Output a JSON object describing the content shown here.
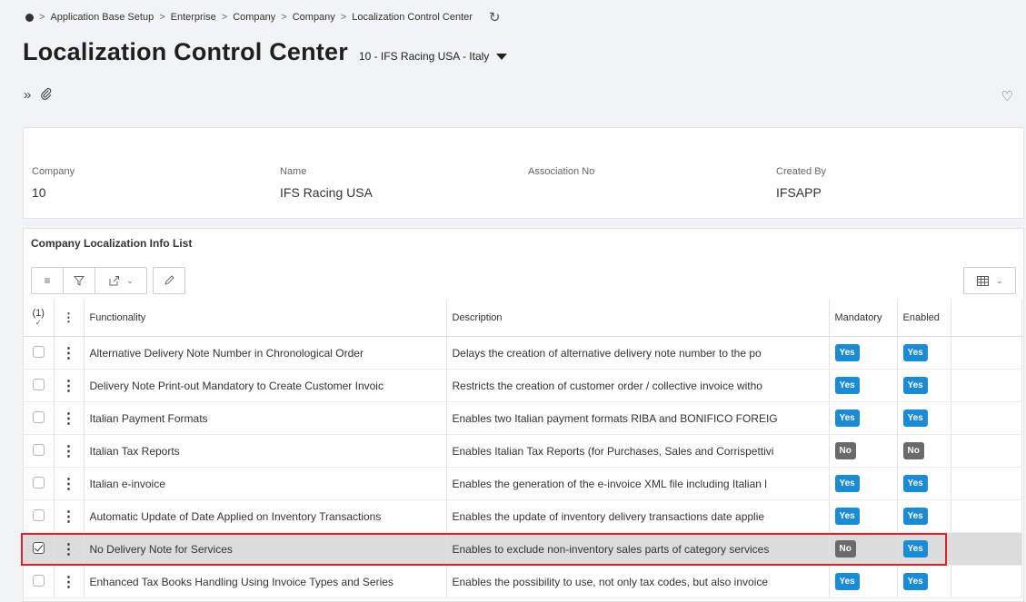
{
  "breadcrumb": {
    "items": [
      "Application Base Setup",
      "Enterprise",
      "Company",
      "Company",
      "Localization Control Center"
    ],
    "separator": ">"
  },
  "page": {
    "title": "Localization Control Center",
    "context": "10 - IFS Racing USA - Italy"
  },
  "header": {
    "fields": [
      {
        "label": "Company",
        "value": "10"
      },
      {
        "label": "Name",
        "value": "IFS Racing USA"
      },
      {
        "label": "Association No",
        "value": ""
      },
      {
        "label": "Created By",
        "value": "IFSAPP"
      }
    ]
  },
  "list": {
    "title": "Company Localization Info List",
    "selected_count": "(1)",
    "columns": {
      "functionality": "Functionality",
      "description": "Description",
      "mandatory": "Mandatory",
      "enabled": "Enabled"
    },
    "rows": [
      {
        "functionality": "Alternative Delivery Note Number in Chronological Order",
        "description": "Delays the creation of alternative delivery note number to the po",
        "mandatory": "Yes",
        "enabled": "Yes",
        "selected": false
      },
      {
        "functionality": "Delivery Note Print-out Mandatory to Create Customer Invoic",
        "description": "Restricts the creation of customer order / collective invoice witho",
        "mandatory": "Yes",
        "enabled": "Yes",
        "selected": false
      },
      {
        "functionality": "Italian Payment Formats",
        "description": "Enables two Italian payment formats RIBA and BONIFICO FOREIG",
        "mandatory": "Yes",
        "enabled": "Yes",
        "selected": false
      },
      {
        "functionality": "Italian Tax Reports",
        "description": "Enables Italian Tax Reports (for Purchases, Sales and Corrispettivi",
        "mandatory": "No",
        "enabled": "No",
        "selected": false
      },
      {
        "functionality": "Italian e-invoice",
        "description": "Enables the generation of the e-invoice XML file including Italian l",
        "mandatory": "Yes",
        "enabled": "Yes",
        "selected": false
      },
      {
        "functionality": "Automatic Update of Date Applied on Inventory Transactions",
        "description": "Enables the update of inventory delivery transactions date applie",
        "mandatory": "Yes",
        "enabled": "Yes",
        "selected": false
      },
      {
        "functionality": "No Delivery Note for Services",
        "description": "Enables to exclude non-inventory sales parts of category services",
        "mandatory": "No",
        "enabled": "Yes",
        "selected": true
      },
      {
        "functionality": "Enhanced Tax Books Handling Using Invoice Types and Series",
        "description": "Enables the possibility to use, not only tax codes, but also invoice",
        "mandatory": "Yes",
        "enabled": "Yes",
        "selected": false
      }
    ]
  },
  "colors": {
    "yes_badge": "#1a8bd4",
    "no_badge": "#6a6a6a",
    "highlight": "#e0202a",
    "selected_row": "#dcdcdc"
  }
}
